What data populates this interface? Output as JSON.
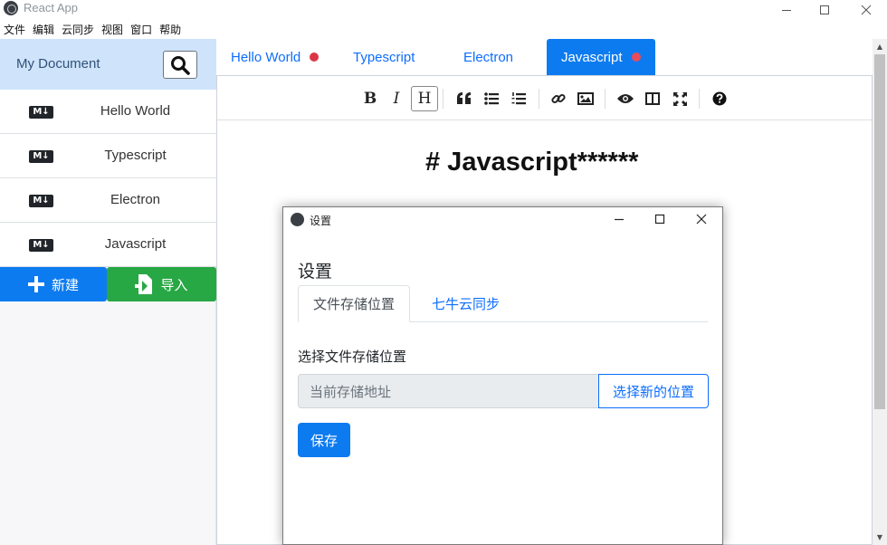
{
  "window": {
    "title": "React App"
  },
  "menubar": [
    "文件",
    "编辑",
    "云同步",
    "视图",
    "窗口",
    "帮助"
  ],
  "sidebar": {
    "title": "My Document",
    "files": [
      {
        "badge": "M↓",
        "name": "Hello World"
      },
      {
        "badge": "M↓",
        "name": "Typescript"
      },
      {
        "badge": "M↓",
        "name": "Electron"
      },
      {
        "badge": "M↓",
        "name": "Javascript"
      }
    ],
    "new_label": "新建",
    "import_label": "导入"
  },
  "tabs": [
    {
      "label": "Hello World",
      "unsaved": true,
      "active": false
    },
    {
      "label": "Typescript",
      "unsaved": false,
      "active": false
    },
    {
      "label": "Electron",
      "unsaved": false,
      "active": false
    },
    {
      "label": "Javascript",
      "unsaved": true,
      "active": true
    }
  ],
  "toolbar": {
    "bold": "B",
    "italic": "I",
    "heading": "H",
    "icons": [
      "quote-icon",
      "unordered-list-icon",
      "ordered-list-icon",
      "link-icon",
      "image-icon",
      "preview-icon",
      "side-by-side-icon",
      "fullscreen-icon",
      "help-icon"
    ]
  },
  "editor": {
    "content": "# Javascript******"
  },
  "dialog": {
    "title": "设置",
    "heading": "设置",
    "tabs": [
      "文件存储位置",
      "七牛云同步"
    ],
    "label": "选择文件存储位置",
    "input_placeholder": "当前存储地址",
    "choose_label": "选择新的位置",
    "save_label": "保存"
  },
  "colors": {
    "primary": "#0d7bf0",
    "success": "#28a745",
    "unsaved_dot": "#dc3545",
    "header_bg": "#cfe3fb"
  }
}
